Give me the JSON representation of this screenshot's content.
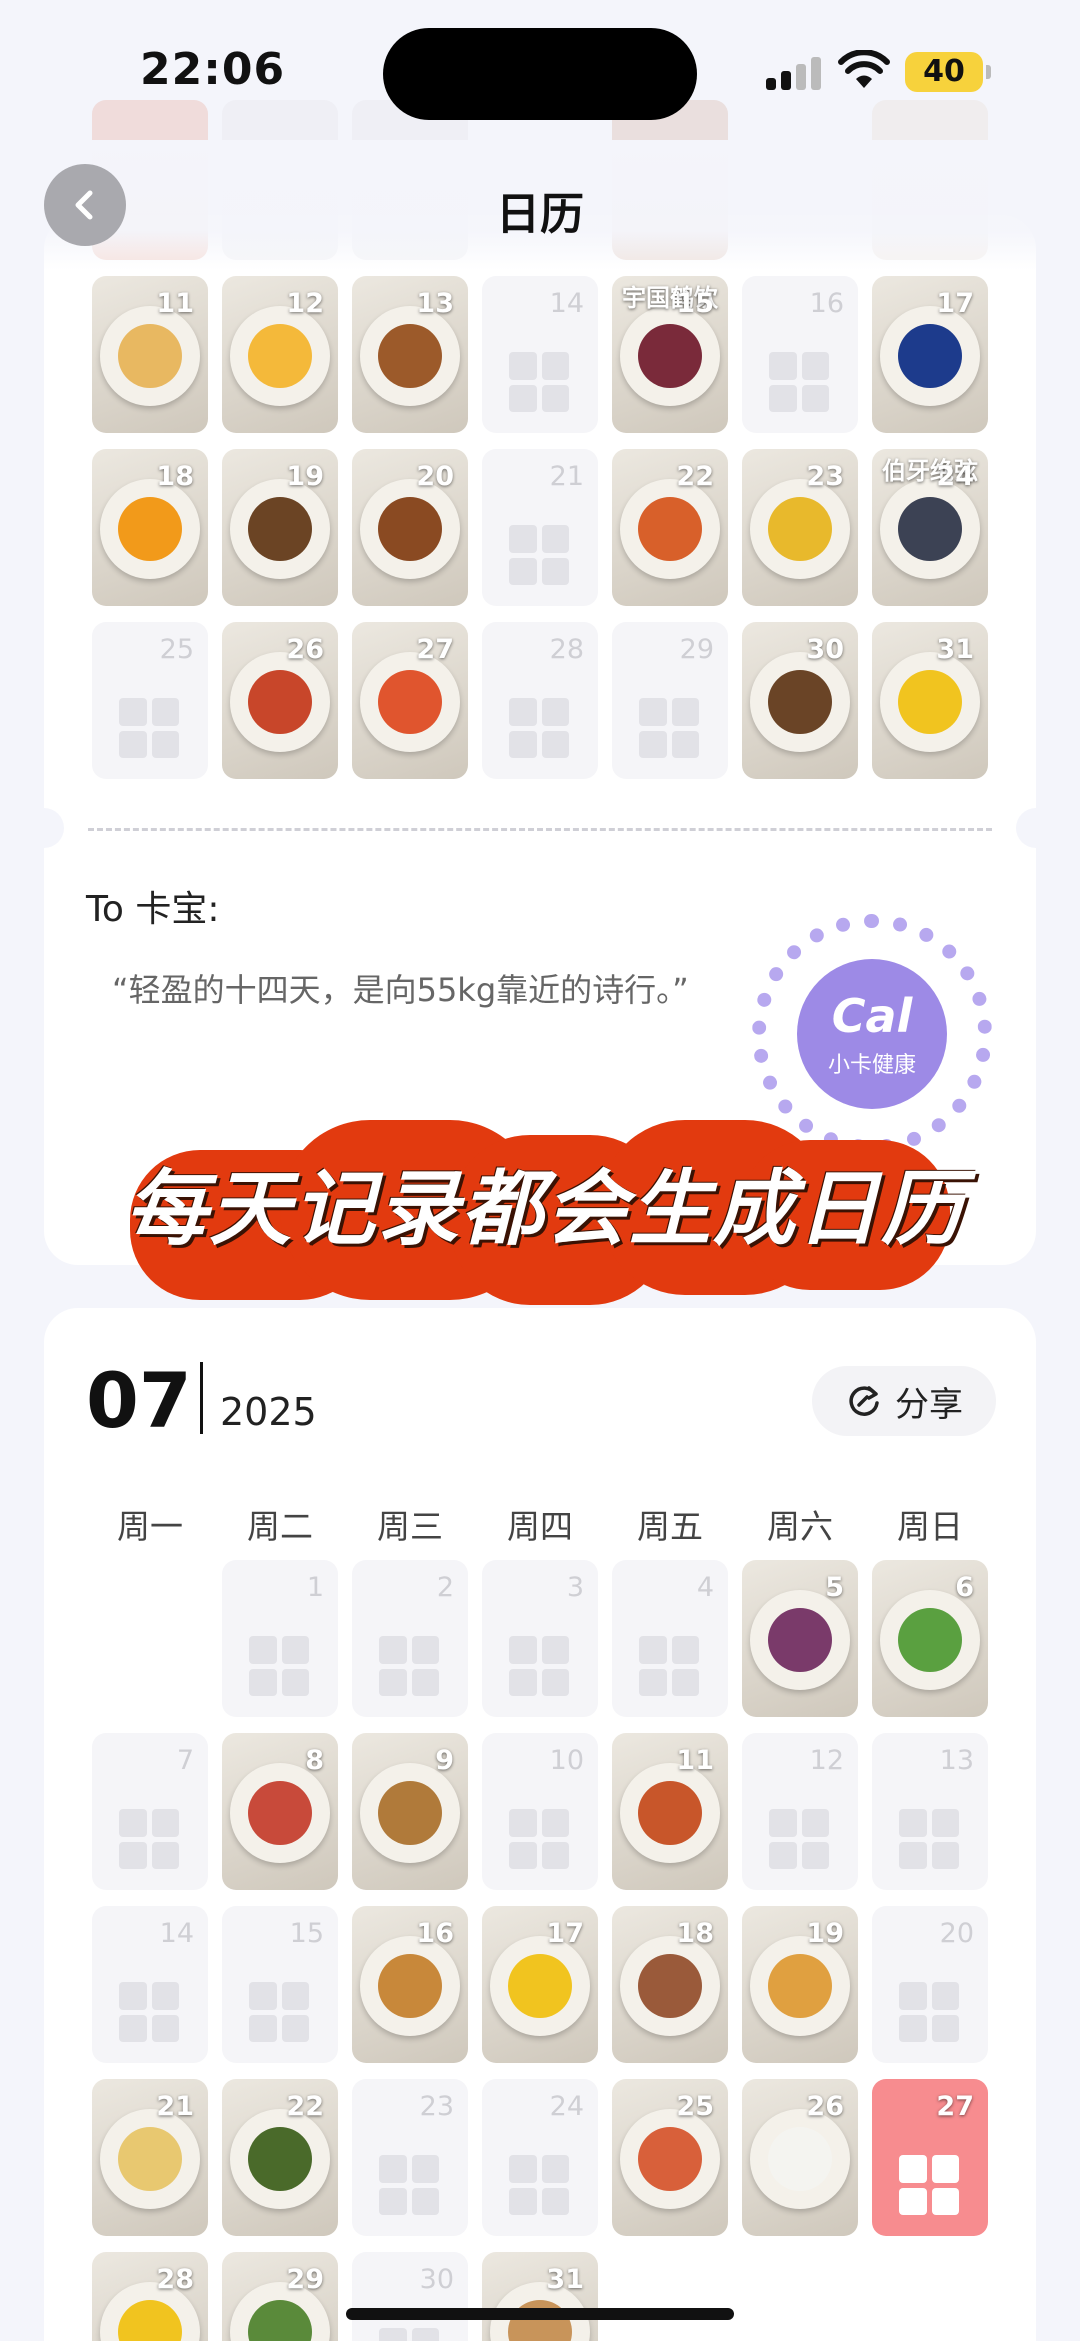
{
  "status": {
    "time": "22:06",
    "battery": "40"
  },
  "header": {
    "title": "日历"
  },
  "june": {
    "rows": [
      [
        {
          "day": "11",
          "filled": true,
          "food": "#e8b861"
        },
        {
          "day": "12",
          "filled": true,
          "food": "#f4b93a"
        },
        {
          "day": "13",
          "filled": true,
          "food": "#9c5a2a"
        },
        {
          "day": "14",
          "filled": false
        },
        {
          "day": "15",
          "filled": true,
          "food": "#7a2a3a",
          "caption": "宇国鹤饮"
        },
        {
          "day": "16",
          "filled": false
        },
        {
          "day": "17",
          "filled": true,
          "food": "#1d3b8c"
        }
      ],
      [
        {
          "day": "18",
          "filled": true,
          "food": "#f29a1a"
        },
        {
          "day": "19",
          "filled": true,
          "food": "#6b4424"
        },
        {
          "day": "20",
          "filled": true,
          "food": "#8a4a22"
        },
        {
          "day": "21",
          "filled": false
        },
        {
          "day": "22",
          "filled": true,
          "food": "#d8602a"
        },
        {
          "day": "23",
          "filled": true,
          "food": "#e8b92c"
        },
        {
          "day": "24",
          "filled": true,
          "food": "#3c4254",
          "caption": "伯牙绝弦"
        }
      ],
      [
        {
          "day": "25",
          "filled": false
        },
        {
          "day": "26",
          "filled": true,
          "food": "#c8462a"
        },
        {
          "day": "27",
          "filled": true,
          "food": "#e0552e"
        },
        {
          "day": "28",
          "filled": false
        },
        {
          "day": "29",
          "filled": false
        },
        {
          "day": "30",
          "filled": true,
          "food": "#6a4426"
        },
        {
          "day": "31",
          "filled": true,
          "food": "#f1c41f"
        }
      ]
    ]
  },
  "message": {
    "to": "To 卡宝:",
    "quote": "“轻盈的十四天，是向55kg靠近的诗行。”",
    "seal_logo": "Cal",
    "seal_text": "小卡健康"
  },
  "banner": {
    "text": "每天记录都会生成日历"
  },
  "july": {
    "month": "07",
    "year": "2025",
    "share_label": "分享",
    "weekdays": [
      "周一",
      "周二",
      "周三",
      "周四",
      "周五",
      "周六",
      "周日"
    ],
    "rows": [
      [
        null,
        {
          "day": "1",
          "filled": false
        },
        {
          "day": "2",
          "filled": false
        },
        {
          "day": "3",
          "filled": false
        },
        {
          "day": "4",
          "filled": false
        },
        {
          "day": "5",
          "filled": true,
          "food": "#7a3a6a"
        },
        {
          "day": "6",
          "filled": true,
          "food": "#5aa040"
        }
      ],
      [
        {
          "day": "7",
          "filled": false
        },
        {
          "day": "8",
          "filled": true,
          "food": "#c84a3a"
        },
        {
          "day": "9",
          "filled": true,
          "food": "#b07a3a"
        },
        {
          "day": "10",
          "filled": false
        },
        {
          "day": "11",
          "filled": true,
          "food": "#c8562a"
        },
        {
          "day": "12",
          "filled": false
        },
        {
          "day": "13",
          "filled": false
        }
      ],
      [
        {
          "day": "14",
          "filled": false
        },
        {
          "day": "15",
          "filled": false
        },
        {
          "day": "16",
          "filled": true,
          "food": "#c8883a"
        },
        {
          "day": "17",
          "filled": true,
          "food": "#f1c41f"
        },
        {
          "day": "18",
          "filled": true,
          "food": "#9a5a3a"
        },
        {
          "day": "19",
          "filled": true,
          "food": "#e0a040"
        },
        {
          "day": "20",
          "filled": false
        }
      ],
      [
        {
          "day": "21",
          "filled": true,
          "food": "#e8c870"
        },
        {
          "day": "22",
          "filled": true,
          "food": "#4a6a2a"
        },
        {
          "day": "23",
          "filled": false
        },
        {
          "day": "24",
          "filled": false
        },
        {
          "day": "25",
          "filled": true,
          "food": "#d8603a"
        },
        {
          "day": "26",
          "filled": true,
          "food": "#f4f4f0"
        },
        {
          "day": "27",
          "filled": false,
          "today": true
        }
      ],
      [
        {
          "day": "28",
          "filled": true,
          "food": "#f1c41f"
        },
        {
          "day": "29",
          "filled": true,
          "food": "#5a8a3a"
        },
        {
          "day": "30",
          "filled": false
        },
        {
          "day": "31",
          "filled": true,
          "food": "#c8945a"
        },
        null,
        null,
        null
      ]
    ]
  },
  "colors": {
    "accent": "#e23a0f",
    "today": "#f78c8f",
    "seal": "#9d8ae6",
    "background": "#f4f5fb"
  }
}
